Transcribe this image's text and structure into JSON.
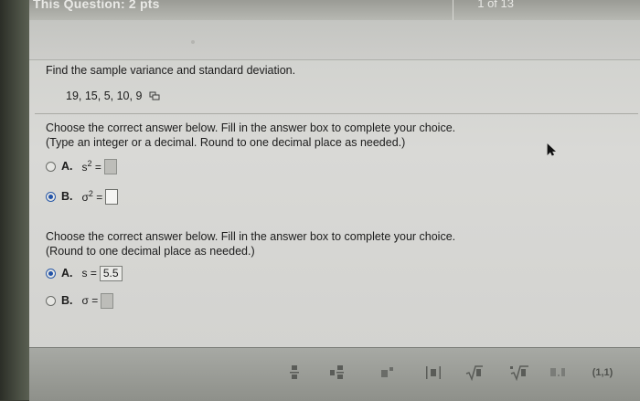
{
  "header": {
    "title": "This Question: 2 pts",
    "count": "1 of 13"
  },
  "question": {
    "prompt": "Find the sample variance and standard deviation.",
    "data": "19, 15, 5, 10, 9"
  },
  "part1": {
    "instruction1": "Choose the correct answer below. Fill in the answer box to complete your choice.",
    "instruction2": "(Type an integer or a decimal. Round to one decimal place as needed.)",
    "options": [
      {
        "label": "A.",
        "symbol": "s",
        "sup": "2",
        "eq": "=",
        "selected": false,
        "value": ""
      },
      {
        "label": "B.",
        "symbol": "σ",
        "sup": "2",
        "eq": "=",
        "selected": true,
        "value": ""
      }
    ]
  },
  "part2": {
    "instruction1": "Choose the correct answer below. Fill in the answer box to complete your choice.",
    "instruction2": "(Round to one decimal place as needed.)",
    "options": [
      {
        "label": "A.",
        "symbol": "s",
        "eq": "=",
        "selected": true,
        "value": "5.5"
      },
      {
        "label": "B.",
        "symbol": "σ",
        "eq": "=",
        "selected": false,
        "value": ""
      }
    ]
  },
  "toolbar": {
    "items": [
      "fraction-icon",
      "mixed-number-icon",
      "exponent-icon",
      "absolute-value-icon",
      "square-root-icon",
      "nth-root-icon",
      "decimal-icon",
      "ordered-pair-icon"
    ],
    "ordered_pair_label": "(1,1)"
  },
  "colors": {
    "panel": "#d9d9d6",
    "selected_radio": "#2253a8",
    "toolbar": "#9b9d98"
  }
}
